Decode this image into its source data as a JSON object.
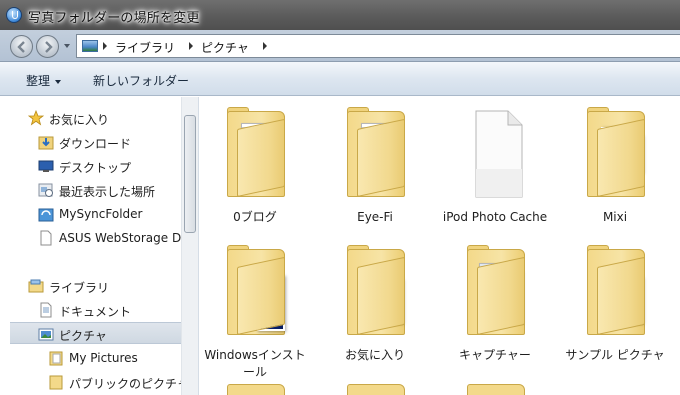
{
  "window": {
    "title": "写真フォルダーの場所を変更"
  },
  "address": {
    "crumbs": [
      "ライブラリ",
      "ピクチャ"
    ]
  },
  "commands": {
    "organize": "整理",
    "new_folder": "新しいフォルダー"
  },
  "navpane": {
    "favorites": {
      "label": "お気に入り",
      "items": [
        "ダウンロード",
        "デスクトップ",
        "最近表示した場所",
        "MySyncFolder",
        "ASUS WebStorage D"
      ]
    },
    "libraries": {
      "label": "ライブラリ",
      "items": [
        "ドキュメント",
        "ピクチャ",
        "My Pictures",
        "パブリックのピクチャ"
      ]
    },
    "selected": "ピクチャ"
  },
  "folders": [
    {
      "label": "0ブログ",
      "icon": "folder-docs-icon"
    },
    {
      "label": "Eye-Fi",
      "icon": "folder-docs-icon"
    },
    {
      "label": "iPod Photo Cache",
      "icon": "blank-file-icon"
    },
    {
      "label": "Mixi",
      "icon": "folder-photos-icon"
    },
    {
      "label": "Windowsインストール",
      "icon": "folder-blue-screen-icon"
    },
    {
      "label": "お気に入り",
      "icon": "folder-strawberry-photos-icon"
    },
    {
      "label": "キャプチャー",
      "icon": "folder-screenshots-icon"
    },
    {
      "label": "サンプル ピクチャ",
      "icon": "folder-red-rock-photos-icon"
    }
  ],
  "colors": {
    "titlebar": "#5b5b5b",
    "folder": "#f3d98a",
    "selection": "#cfd8e2"
  }
}
